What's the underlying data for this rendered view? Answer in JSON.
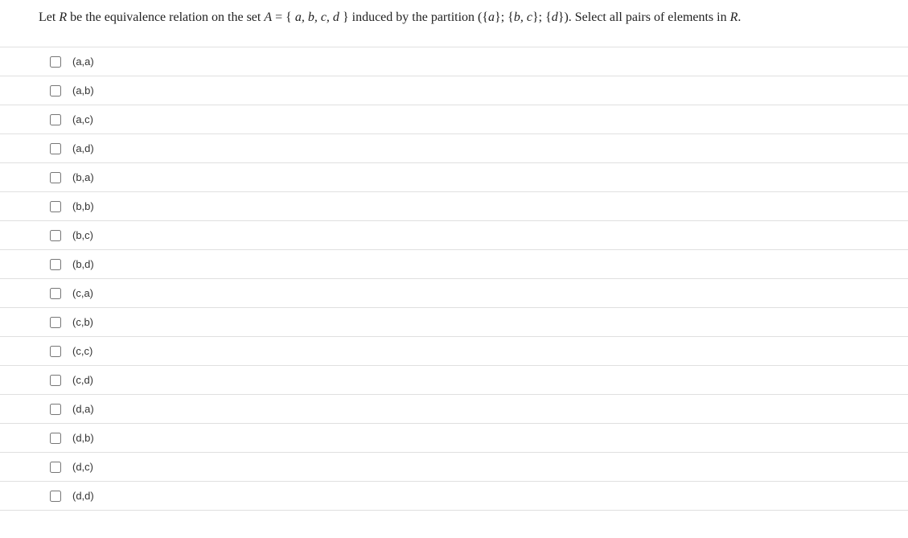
{
  "question": {
    "prefix": "Let ",
    "var_R": "R",
    "text1": " be the equivalence relation on the set ",
    "var_A": "A",
    "text2": " = { ",
    "set_elements": "a, b, c, d",
    "text3": " } induced by the partition ({",
    "p1": "a",
    "text4": "}; {",
    "p2": "b, c",
    "text5": "}; {",
    "p3": "d",
    "text6": "}). Select all pairs of elements in ",
    "var_R2": "R",
    "text7": "."
  },
  "options": [
    {
      "label": "(a,a)"
    },
    {
      "label": "(a,b)"
    },
    {
      "label": "(a,c)"
    },
    {
      "label": "(a,d)"
    },
    {
      "label": "(b,a)"
    },
    {
      "label": "(b,b)"
    },
    {
      "label": "(b,c)"
    },
    {
      "label": "(b,d)"
    },
    {
      "label": "(c,a)"
    },
    {
      "label": "(c,b)"
    },
    {
      "label": "(c,c)"
    },
    {
      "label": "(c,d)"
    },
    {
      "label": "(d,a)"
    },
    {
      "label": "(d,b)"
    },
    {
      "label": "(d,c)"
    },
    {
      "label": "(d,d)"
    }
  ]
}
